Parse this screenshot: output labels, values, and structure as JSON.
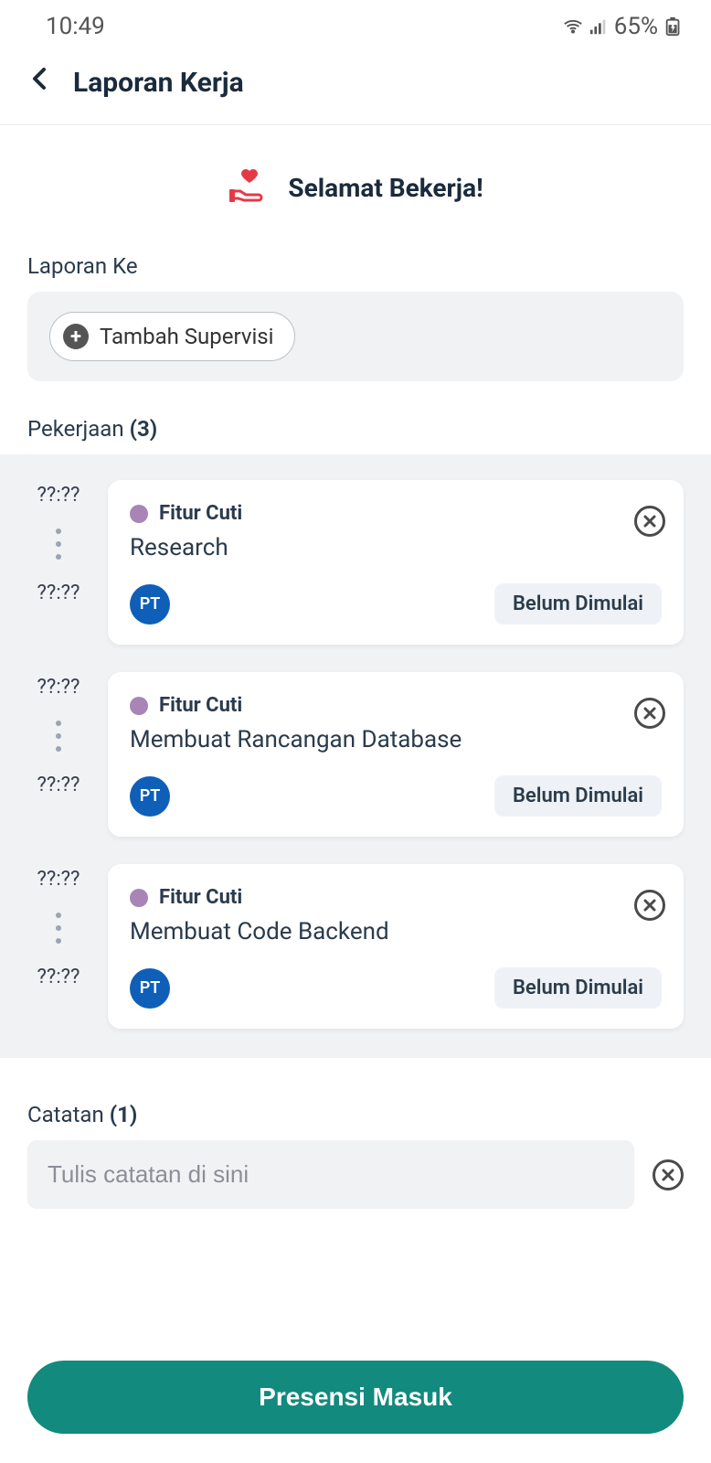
{
  "statusBar": {
    "time": "10:49",
    "battery": "65%"
  },
  "header": {
    "title": "Laporan Kerja"
  },
  "greeting": {
    "text": "Selamat Bekerja!"
  },
  "supervisi": {
    "label": "Laporan Ke",
    "chipLabel": "Tambah Supervisi"
  },
  "tasks": {
    "label": "Pekerjaan",
    "count": "(3)",
    "items": [
      {
        "timeStart": "??:??",
        "timeEnd": "??:??",
        "tag": "Fitur Cuti",
        "title": "Research",
        "avatar": "PT",
        "status": "Belum Dimulai"
      },
      {
        "timeStart": "??:??",
        "timeEnd": "??:??",
        "tag": "Fitur Cuti",
        "title": "Membuat Rancangan Database",
        "avatar": "PT",
        "status": "Belum Dimulai"
      },
      {
        "timeStart": "??:??",
        "timeEnd": "??:??",
        "tag": "Fitur Cuti",
        "title": "Membuat Code Backend",
        "avatar": "PT",
        "status": "Belum Dimulai"
      }
    ]
  },
  "notes": {
    "label": "Catatan",
    "count": "(1)",
    "placeholder": "Tulis catatan di sini"
  },
  "primaryButton": "Presensi Masuk",
  "colors": {
    "accent": "#128a7e",
    "tagDot": "#a885b5",
    "avatarBg": "#0f5fb8",
    "heartIcon": "#e63946"
  }
}
